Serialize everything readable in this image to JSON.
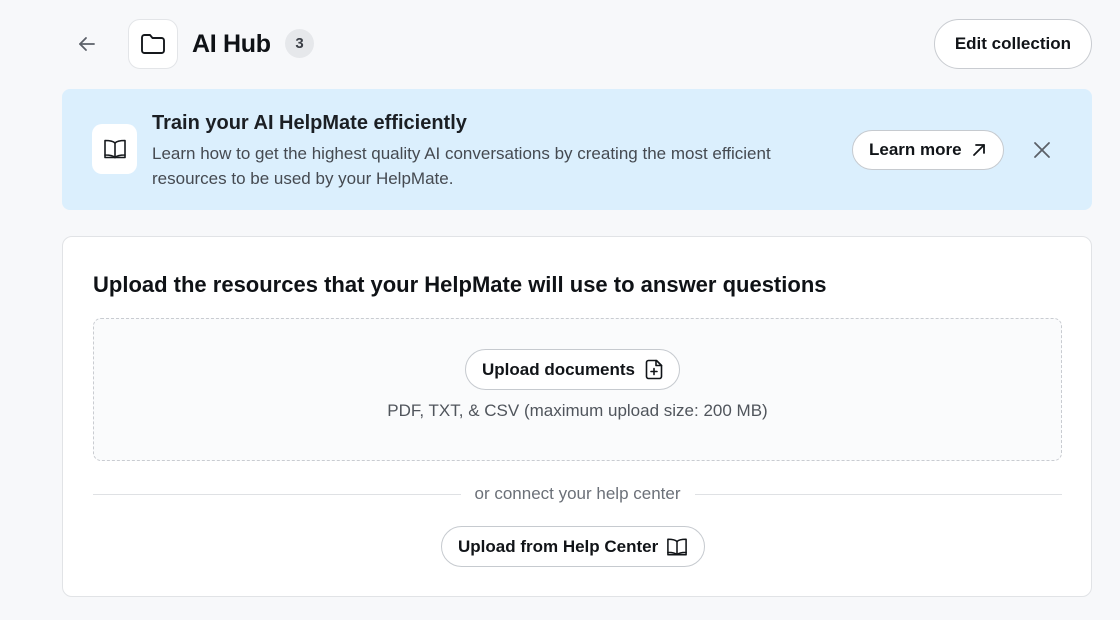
{
  "header": {
    "title": "AI Hub",
    "count": "3",
    "edit_label": "Edit collection",
    "back_icon": "arrow-left-icon",
    "folder_icon": "folder-icon"
  },
  "banner": {
    "title": "Train your AI HelpMate efficiently",
    "description": "Learn how to get the highest quality AI conversations by creating the most efficient resources to be used by your HelpMate.",
    "learn_more_label": "Learn more",
    "icon": "book-open-icon",
    "background": "#dbeffd"
  },
  "upload": {
    "title": "Upload the resources that your HelpMate will use to answer questions",
    "upload_button_label": "Upload documents",
    "hint": "PDF, TXT, & CSV (maximum upload size: 200 MB)",
    "divider_text": "or connect your help center",
    "help_center_button_label": "Upload from Help Center"
  },
  "colors": {
    "page_bg": "#f7f8fa",
    "banner_bg": "#dbeffd",
    "text_primary": "#111418",
    "text_secondary": "#50555c"
  }
}
